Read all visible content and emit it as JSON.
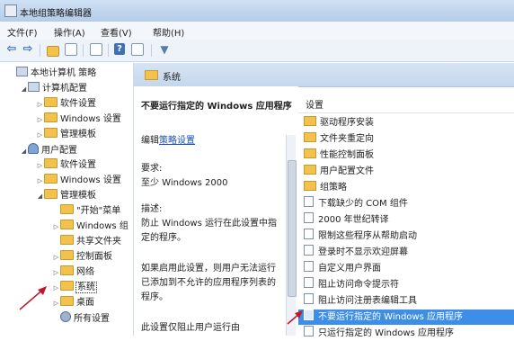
{
  "window": {
    "title": "本地组策略编辑器"
  },
  "menu": [
    "文件(F)",
    "操作(A)",
    "查看(V)",
    "帮助(H)"
  ],
  "toolbar": {
    "buttons": [
      "back-arrow",
      "forward-arrow",
      "up-folder",
      "show-hide-tree",
      "export-list",
      "help",
      "properties",
      "filter"
    ]
  },
  "tree": {
    "items": [
      {
        "label": "本地计算机 策略"
      },
      {
        "label": "计算机配置"
      },
      {
        "label": "软件设置"
      },
      {
        "label": "Windows 设置"
      },
      {
        "label": "管理模板"
      },
      {
        "label": "用户配置"
      },
      {
        "label": "软件设置"
      },
      {
        "label": "Windows 设置"
      },
      {
        "label": "管理模板"
      },
      {
        "label": "\"开始\"菜单"
      },
      {
        "label": "Windows 组"
      },
      {
        "label": "共享文件夹"
      },
      {
        "label": "控制面板"
      },
      {
        "label": "网络"
      },
      {
        "label": "系统"
      },
      {
        "label": "桌面"
      },
      {
        "label": "所有设置"
      }
    ]
  },
  "pane": {
    "header": "系统",
    "description": {
      "title": "不要运行指定的 Windows 应用程序",
      "edit_prefix": "编辑",
      "edit_link": "策略设置",
      "requirement_label": "要求:",
      "requirement_value": "至少 Windows 2000",
      "desc_label": "描述:",
      "desc_line1": "防止 Windows 运行在此设置中指",
      "desc_line2": "定的程序。",
      "note_line1": "如果启用此设置，则用户无法运行",
      "note_line2": "已添加到不允许的应用程序列表的",
      "note_line3": "程序。",
      "note_line4": "此设置仅阻止用户运行由"
    },
    "list": {
      "column": "设置",
      "rows": [
        {
          "label": "驱动程序安装",
          "kind": "folder"
        },
        {
          "label": "文件夹重定向",
          "kind": "folder"
        },
        {
          "label": "性能控制面板",
          "kind": "folder"
        },
        {
          "label": "用户配置文件",
          "kind": "folder"
        },
        {
          "label": "组策略",
          "kind": "folder"
        },
        {
          "label": "下载缺少的 COM 组件",
          "kind": "policy"
        },
        {
          "label": "2000 年世纪转译",
          "kind": "policy"
        },
        {
          "label": "限制这些程序从帮助启动",
          "kind": "policy"
        },
        {
          "label": "登录时不显示欢迎屏幕",
          "kind": "policy"
        },
        {
          "label": "自定义用户界面",
          "kind": "policy"
        },
        {
          "label": "阻止访问命令提示符",
          "kind": "policy"
        },
        {
          "label": "阻止访问注册表编辑工具",
          "kind": "policy"
        },
        {
          "label": "不要运行指定的 Windows 应用程序",
          "kind": "policy"
        },
        {
          "label": "只运行指定的 Windows 应用程序",
          "kind": "policy"
        }
      ]
    }
  },
  "colors": {
    "selection": "#3d8ee6",
    "annotation": "#c0182a",
    "link": "#1a4fb5"
  }
}
